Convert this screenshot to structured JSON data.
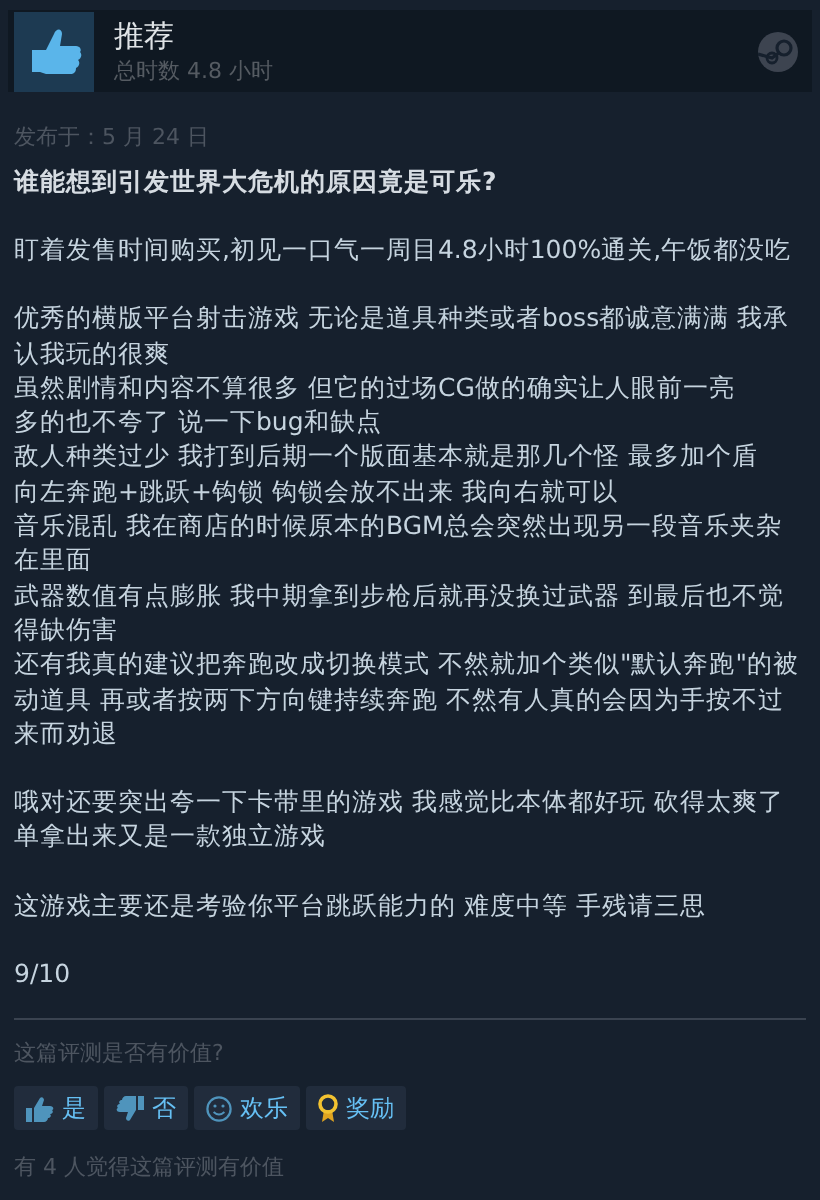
{
  "header": {
    "verdict": "推荐",
    "playtime": "总时数 4.8 小时"
  },
  "review": {
    "posted": "发布于：5 月 24 日",
    "title": "谁能想到引发世界大危机的原因竟是可乐?",
    "paragraphs": [
      {
        "lines": [
          "盯着发售时间购买,初见一口气一周目4.8小时100%通关,午饭都没吃"
        ]
      },
      {
        "lines": [
          "优秀的横版平台射击游戏 无论是道具种类或者boss都诚意满满 我承认我玩的很爽",
          "虽然剧情和内容不算很多 但它的过场CG做的确实让人眼前一亮",
          "多的也不夸了 说一下bug和缺点",
          "敌人种类过少 我打到后期一个版面基本就是那几个怪 最多加个盾",
          "向左奔跑+跳跃+钩锁 钩锁会放不出来 我向右就可以",
          "音乐混乱 我在商店的时候原本的BGM总会突然出现另一段音乐夹杂在里面",
          "武器数值有点膨胀 我中期拿到步枪后就再没换过武器 到最后也不觉得缺伤害",
          "还有我真的建议把奔跑改成切换模式 不然就加个类似\"默认奔跑\"的被动道具 再或者按两下方向键持续奔跑 不然有人真的会因为手按不过来而劝退"
        ]
      },
      {
        "lines": [
          "哦对还要突出夸一下卡带里的游戏 我感觉比本体都好玩 砍得太爽了单拿出来又是一款独立游戏"
        ]
      },
      {
        "lines": [
          "这游戏主要还是考验你平台跳跃能力的 难度中等 手残请三思"
        ]
      },
      {
        "lines": [
          "9/10"
        ]
      }
    ]
  },
  "feedback": {
    "question": "这篇评测是否有价值?",
    "buttons": [
      {
        "kind": "yes",
        "label": "是"
      },
      {
        "kind": "no",
        "label": "否"
      },
      {
        "kind": "funny",
        "label": "欢乐"
      },
      {
        "kind": "award",
        "label": "奖励"
      }
    ],
    "helpful_count": "有 4 人觉得这篇评测有价值"
  }
}
